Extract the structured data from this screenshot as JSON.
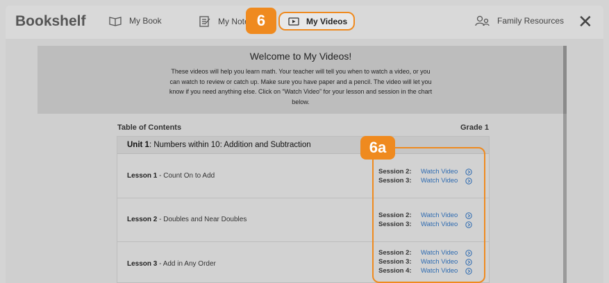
{
  "app": {
    "title": "Bookshelf"
  },
  "nav": {
    "my_book": "My Book",
    "my_notes": "My Notes",
    "my_videos": "My Videos",
    "family_resources": "Family Resources"
  },
  "callouts": {
    "tab": "6",
    "sessions": "6a"
  },
  "welcome": {
    "title": "Welcome to My Videos!",
    "body": "These videos will help you learn math. Your teacher will tell you when to watch a video, or you can watch to review or catch up. Make sure you have paper and a pencil. The video will let you know if you need anything else. Click on “Watch Video” for your lesson and session  in the chart below."
  },
  "toc": {
    "label": "Table of Contents",
    "grade": "Grade 1",
    "unit": {
      "number": "Unit 1",
      "title": ": Numbers within 10: Addition and Subtraction"
    },
    "lessons": [
      {
        "number": "Lesson 1",
        "title": " - Count On to Add",
        "sessions": [
          {
            "name": "Session 2:",
            "link": "Watch Video"
          },
          {
            "name": "Session 3:",
            "link": "Watch Video"
          }
        ]
      },
      {
        "number": "Lesson 2",
        "title": " - Doubles and Near Doubles",
        "sessions": [
          {
            "name": "Session 2:",
            "link": "Watch Video"
          },
          {
            "name": "Session 3:",
            "link": "Watch Video"
          }
        ]
      },
      {
        "number": "Lesson 3",
        "title": " - Add in Any Order",
        "sessions": [
          {
            "name": "Session 2:",
            "link": "Watch Video"
          },
          {
            "name": "Session 3:",
            "link": "Watch Video"
          },
          {
            "name": "Session 4:",
            "link": "Watch Video"
          }
        ]
      }
    ]
  },
  "colors": {
    "accent": "#ef8a1f",
    "link": "#2d6ab0"
  }
}
